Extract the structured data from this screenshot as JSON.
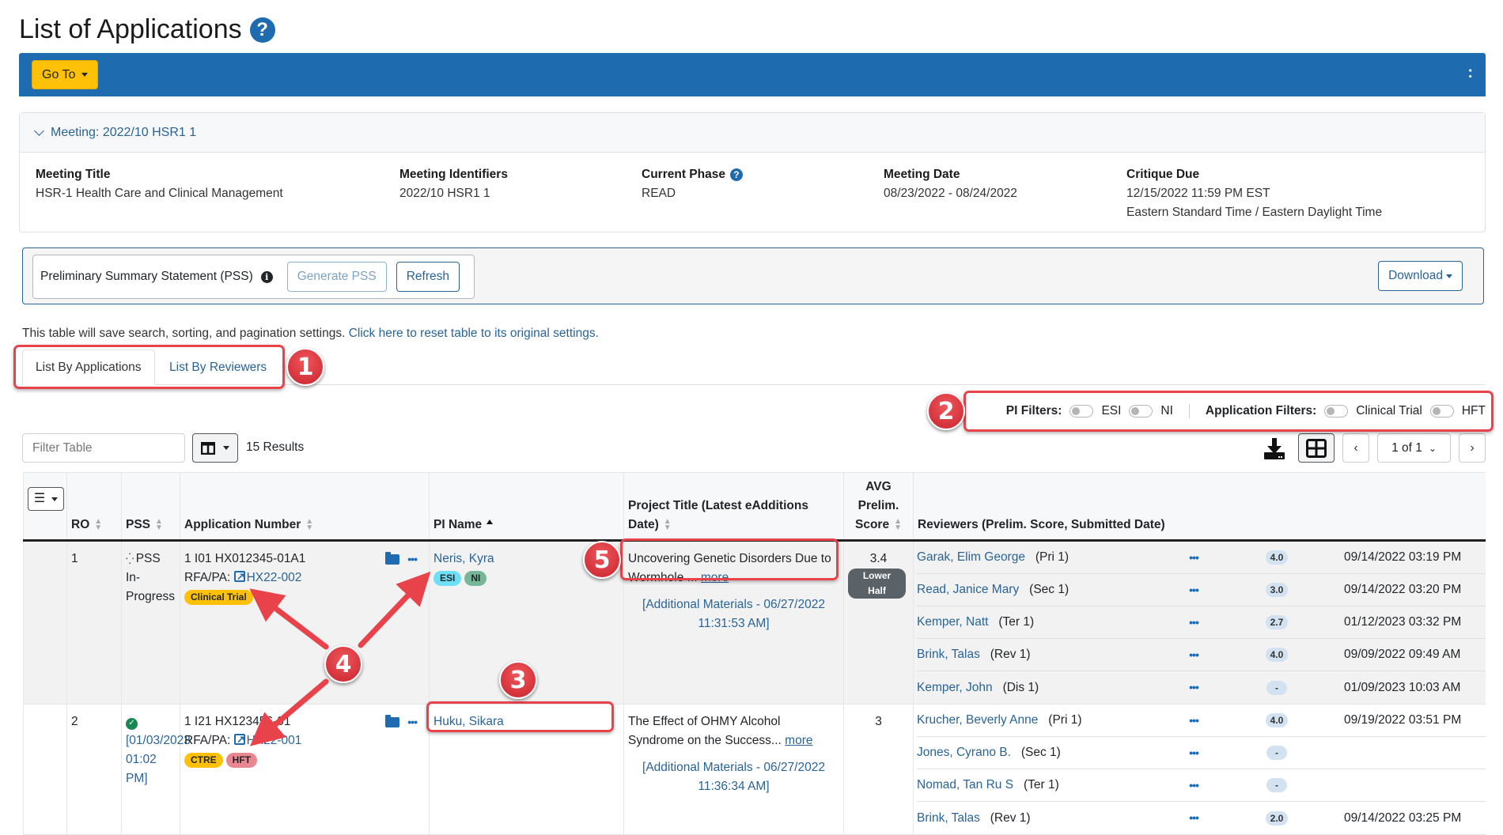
{
  "page": {
    "title": "List of Applications",
    "help_icon": "question-circle-icon"
  },
  "toolbar": {
    "goto_label": "Go To",
    "kebab_label": ":"
  },
  "meeting": {
    "header_label": "Meeting:",
    "header_value": "2022/10 HSR1 1",
    "fields": [
      {
        "label": "Meeting Title",
        "value": "HSR-1 Health Care and Clinical Management"
      },
      {
        "label": "Meeting Identifiers",
        "value": "2022/10 HSR1 1"
      },
      {
        "label": "Current Phase",
        "value": "READ"
      },
      {
        "label": "Meeting Date",
        "value": "08/23/2022 - 08/24/2022"
      },
      {
        "label": "Critique Due",
        "value": "12/15/2022 11:59 PM EST",
        "value2": "Eastern Standard Time / Eastern Daylight Time"
      }
    ]
  },
  "pss": {
    "label": "Preliminary Summary Statement (PSS)",
    "generate_label": "Generate PSS",
    "refresh_label": "Refresh",
    "download_label": "Download"
  },
  "notice": {
    "text": "This table will save search, sorting, and pagination settings.",
    "link": "Click here to reset table to its original settings."
  },
  "tabs": [
    {
      "label": "List By Applications",
      "active": true
    },
    {
      "label": "List By Reviewers",
      "active": false
    }
  ],
  "filters": {
    "pi_label": "PI Filters:",
    "pi": [
      {
        "label": "ESI",
        "on": false
      },
      {
        "label": "NI",
        "on": false
      }
    ],
    "app_label": "Application Filters:",
    "app": [
      {
        "label": "Clinical Trial",
        "on": false
      },
      {
        "label": "HFT",
        "on": false
      }
    ]
  },
  "table_controls": {
    "filter_placeholder": "Filter Table",
    "results": "15 Results",
    "page_label": "1 of 1"
  },
  "columns": [
    {
      "label": ""
    },
    {
      "label": "RO",
      "sort": "none"
    },
    {
      "label": "PSS",
      "sort": "none"
    },
    {
      "label": "Application Number",
      "sort": "none"
    },
    {
      "label": "PI Name",
      "sort": "asc"
    },
    {
      "label": "Project Title (Latest eAdditions Date)",
      "sort": "none"
    },
    {
      "label": "AVG Prelim. Score",
      "sort": "none"
    },
    {
      "label": "Reviewers (Prelim. Score, Submitted Date)"
    }
  ],
  "rows": [
    {
      "ro": "1",
      "pss_status": "PSS In-Progress",
      "pss_icon": "spinner-icon",
      "app_number": "1 I01 HX012345-01A1",
      "rfa_label": "RFA/PA:",
      "rfa": "HX22-002",
      "app_badges": [
        {
          "label": "Clinical Trial",
          "color": "#ffc107"
        }
      ],
      "pi_name": "Neris, Kyra",
      "pi_badges": [
        {
          "label": "ESI",
          "color": "#6edff6"
        },
        {
          "label": "NI",
          "color": "#75b798"
        }
      ],
      "project_title": "Uncovering Genetic Disorders Due to Wormhole ...",
      "more_label": "more",
      "additional": "[Additional Materials - 06/27/2022 11:31:53 AM]",
      "avg_score": "3.4",
      "avg_badge": "Lower Half",
      "reviewers": [
        {
          "name": "Garak, Elim George",
          "role": "(Pri 1)",
          "score": "4.0",
          "date": "09/14/2022 03:19 PM"
        },
        {
          "name": "Read, Janice Mary",
          "role": "(Sec 1)",
          "score": "3.0",
          "date": "09/14/2022 03:20 PM"
        },
        {
          "name": "Kemper, Natt",
          "role": "(Ter 1)",
          "score": "2.7",
          "date": "01/12/2023 03:32 PM"
        },
        {
          "name": "Brink, Talas",
          "role": "(Rev 1)",
          "score": "4.0",
          "date": "09/09/2022 09:49 AM"
        },
        {
          "name": "Kemper, John",
          "role": "(Dis 1)",
          "score": "-",
          "date": "01/09/2023 10:03 AM"
        }
      ]
    },
    {
      "ro": "2",
      "pss_status": "[01/03/2023 01:02 PM]",
      "pss_icon": "check-circle-icon",
      "app_number": "1 I21 HX123456-01",
      "rfa_label": "RFA/PA:",
      "rfa": "HX22-001",
      "app_badges": [
        {
          "label": "CTRE",
          "color": "#ffc107"
        },
        {
          "label": "HFT",
          "color": "#ea868f"
        }
      ],
      "pi_name": "Huku, Sikara",
      "pi_badges": [],
      "project_title": "The Effect of OHMY Alcohol Syndrome on the Success...",
      "more_label": "more",
      "additional": "[Additional Materials - 06/27/2022 11:36:34 AM]",
      "avg_score": "3",
      "avg_badge": "",
      "reviewers": [
        {
          "name": "Krucher, Beverly Anne",
          "role": "(Pri 1)",
          "score": "4.0",
          "date": "09/19/2022 03:51 PM"
        },
        {
          "name": "Jones, Cyrano B.",
          "role": "(Sec 1)",
          "score": "-",
          "date": ""
        },
        {
          "name": "Nomad, Tan Ru  S",
          "role": "(Ter 1)",
          "score": "-",
          "date": ""
        },
        {
          "name": "Brink, Talas",
          "role": "(Rev 1)",
          "score": "2.0",
          "date": "09/14/2022 03:25 PM"
        }
      ]
    }
  ],
  "annotations": [
    {
      "number": "1",
      "target": "tabs"
    },
    {
      "number": "2",
      "target": "filters"
    },
    {
      "number": "3",
      "target": "pi-name-row-2"
    },
    {
      "number": "4",
      "target": "badges"
    },
    {
      "number": "5",
      "target": "project-title-row-1"
    }
  ],
  "colors": {
    "brand_blue": "#1f6bb0",
    "goto_yellow": "#ffc107",
    "annotation_red": "#e8434b",
    "link": "#2a6496"
  }
}
